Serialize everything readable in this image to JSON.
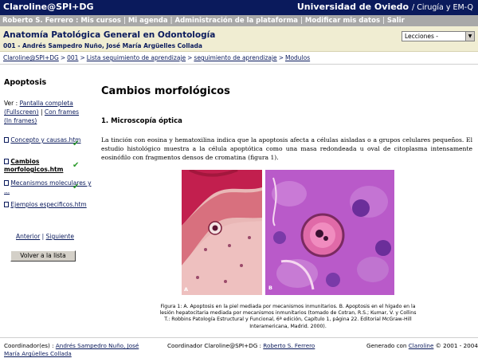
{
  "topbar": {
    "brand": "Claroline@SPI+DG",
    "university": "Universidad de Oviedo",
    "university_sub": "/ Cirugía y EM-Q"
  },
  "userbar": {
    "items": [
      "Roberto S. Ferrero : Mis cursos",
      "Mi agenda",
      "Administración de la plataforma",
      "Modificar mis datos",
      "Salir"
    ]
  },
  "course": {
    "title": "Anatomía Patológica General en Odontología",
    "authors": "001 - Andrés Sampedro Nuño, José María Argüelles Collada",
    "select_value": "Lecciones -"
  },
  "breadcrumbs": [
    "Claroline@SPI+DG",
    "001",
    "Lista seguimiento de aprendizaje",
    "seguimiento de aprendizaje",
    "Modulos"
  ],
  "sidebar": {
    "title": "Apoptosis",
    "ver_label": "Ver :",
    "fullscreen_link": "Pantalla completa (Fullscreen)",
    "frames_link": "Con frames (In frames)",
    "items": [
      {
        "label": "Concepto y causas.htm"
      },
      {
        "label": "Cambios morfologicos.htm"
      },
      {
        "label": "Mecanismos moleculares y ..."
      },
      {
        "label": "Ejemplos especificos.htm"
      }
    ],
    "prev_link": "Anterior",
    "next_link": "Siguiente",
    "back_button": "Volver a la lista"
  },
  "content": {
    "title": "Cambios morfológicos",
    "section": "1. Microscopía óptica",
    "paragraph": "La tinción con eosina y hematoxilina indica que la apoptosis afecta a células aisladas o a grupos celulares pequeños. El estudio histológico muestra a la célula apoptótica como una masa redondeada u oval de citoplasma intensamente eosinófilo con fragmentos densos de cromatina (figura 1).",
    "img_label_a": "A",
    "img_label_b": "B",
    "caption": "Figura 1: A. Apoptosis en la piel mediada por mecanismos inmunitarios. B. Apoptosis en el hígado en la lesión hepatocitaria mediada por mecanismos inmunitarios (tomado de Cotran, R.S.; Kumar, V. y Collins T.: Robbins Patología Estructural y Funcional, 6ª edición, Capítulo 1, página 22. Editorial McGraw-Hill Interamericana, Madrid. 2000)."
  },
  "footer": {
    "coordinators_label": "Coordinador(es) :",
    "coordinators": "Andrés Sampedro Nuño, José María Argüelles Collada",
    "platform_label": "Coordinador Claroline@SPI+DG :",
    "platform_coordinator": "Roberto S. Ferrero",
    "generated_label": "Generado con",
    "generated_link": "Claroline",
    "copyright": "© 2001 - 2004"
  },
  "colors": {
    "navy": "#0a1a5c",
    "grey_bar": "#a8a8a8",
    "course_bar": "#f0edd2",
    "check": "#2a9a2a",
    "stain_pink": "#e4a8ab",
    "stain_purple": "#b654c8"
  }
}
